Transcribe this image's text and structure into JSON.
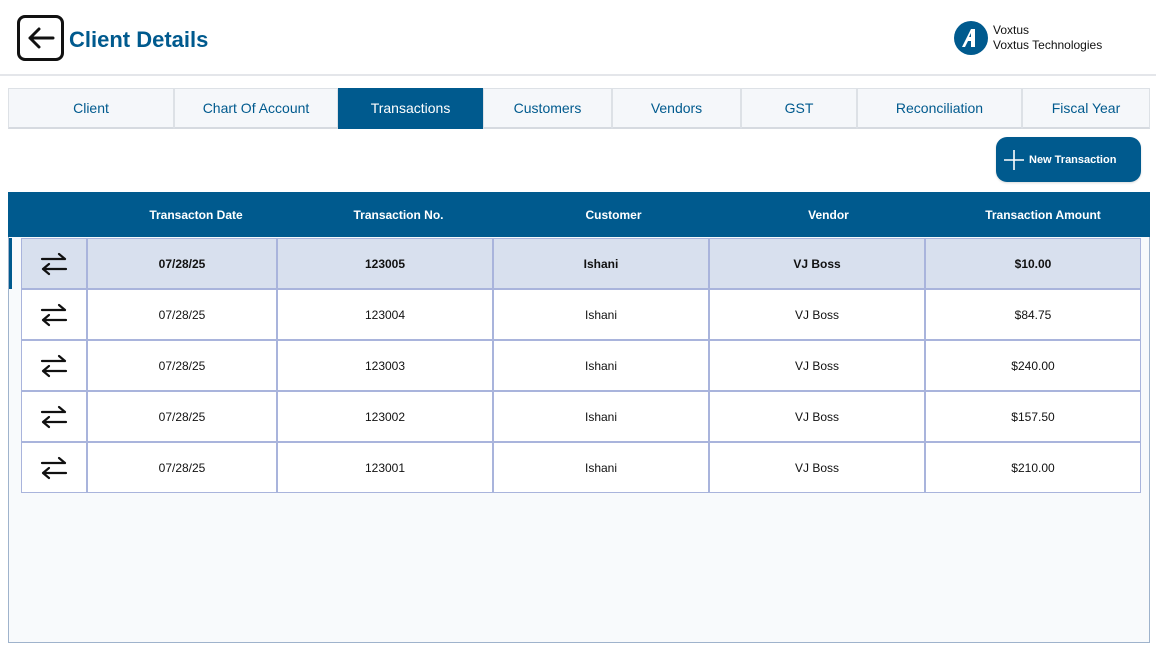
{
  "header": {
    "title": "Client Details",
    "brand_name": "Voxtus",
    "brand_company": "Voxtus Technologies"
  },
  "tabs": [
    {
      "label": "Client",
      "active": false
    },
    {
      "label": "Chart Of Account",
      "active": false
    },
    {
      "label": "Transactions",
      "active": true
    },
    {
      "label": "Customers",
      "active": false
    },
    {
      "label": "Vendors",
      "active": false
    },
    {
      "label": "GST",
      "active": false
    },
    {
      "label": "Reconciliation",
      "active": false
    },
    {
      "label": "Fiscal Year",
      "active": false
    }
  ],
  "actions": {
    "new_transaction_label": "New Transaction"
  },
  "table": {
    "columns": [
      "",
      "Transacton Date",
      "Transaction No.",
      "Customer",
      "Vendor",
      "Transaction Amount"
    ],
    "rows": [
      {
        "date": "07/28/25",
        "number": "123005",
        "customer": "Ishani",
        "vendor": "VJ Boss",
        "amount": "$10.00",
        "selected": true
      },
      {
        "date": "07/28/25",
        "number": "123004",
        "customer": "Ishani",
        "vendor": "VJ Boss",
        "amount": "$84.75",
        "selected": false
      },
      {
        "date": "07/28/25",
        "number": "123003",
        "customer": "Ishani",
        "vendor": "VJ Boss",
        "amount": "$240.00",
        "selected": false
      },
      {
        "date": "07/28/25",
        "number": "123002",
        "customer": "Ishani",
        "vendor": "VJ Boss",
        "amount": "$157.50",
        "selected": false
      },
      {
        "date": "07/28/25",
        "number": "123001",
        "customer": "Ishani",
        "vendor": "VJ Boss",
        "amount": "$210.00",
        "selected": false
      }
    ]
  },
  "icons": {
    "back": "arrow-left-icon",
    "brand": "voxtus-logo",
    "add": "plus-icon",
    "row": "swap-arrows-icon"
  },
  "colors": {
    "primary": "#005a8e",
    "selected_row": "#d8e0ee",
    "cell_border": "#a9b4dc"
  }
}
